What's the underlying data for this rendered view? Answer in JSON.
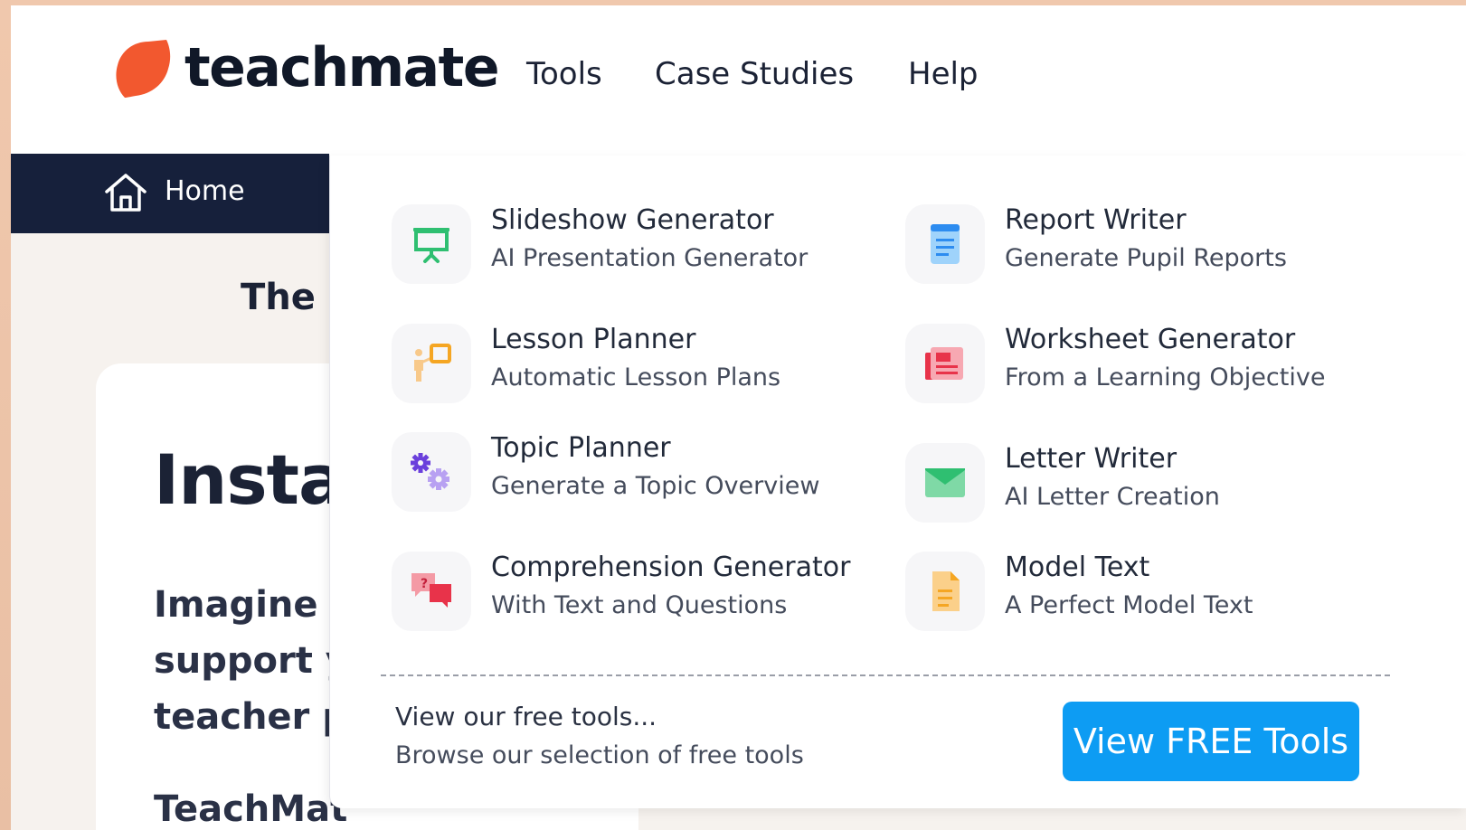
{
  "brand": {
    "name": "teachmate",
    "accent": "#f2582f"
  },
  "nav": {
    "tools": "Tools",
    "case_studies": "Case Studies",
    "help": "Help"
  },
  "home": {
    "label": "Home"
  },
  "page": {
    "heading_fragment": "The",
    "hero_fragment": "Insta",
    "lines": [
      "Imagine h",
      "support y",
      "teacher p",
      "TeachMat"
    ]
  },
  "dropdown": {
    "tools": [
      {
        "title": "Slideshow Generator",
        "subtitle": "AI Presentation Generator",
        "icon": "presentation-board-icon",
        "color": "#2fbf71"
      },
      {
        "title": "Report Writer",
        "subtitle": "Generate Pupil Reports",
        "icon": "document-icon",
        "color": "#2d8cf0"
      },
      {
        "title": "Lesson Planner",
        "subtitle": "Automatic Lesson Plans",
        "icon": "teacher-board-icon",
        "color": "#f5a623"
      },
      {
        "title": "Worksheet Generator",
        "subtitle": "From a Learning Objective",
        "icon": "worksheet-icon",
        "color": "#e8334a"
      },
      {
        "title": "Topic Planner",
        "subtitle": "Generate a Topic Overview",
        "icon": "gears-icon",
        "color": "#7b4be8"
      },
      {
        "title": "Letter Writer",
        "subtitle": "AI Letter Creation",
        "icon": "envelope-icon",
        "color": "#2fbf71"
      },
      {
        "title": "Comprehension Generator",
        "subtitle": "With Text and Questions",
        "icon": "question-bubbles-icon",
        "color": "#e8334a"
      },
      {
        "title": "Model Text",
        "subtitle": "A Perfect Model Text",
        "icon": "text-file-icon",
        "color": "#f5a623"
      }
    ],
    "free": {
      "title": "View our free tools...",
      "subtitle": "Browse our selection of free tools",
      "button": "View FREE Tools",
      "button_color": "#0d9cf3"
    }
  }
}
